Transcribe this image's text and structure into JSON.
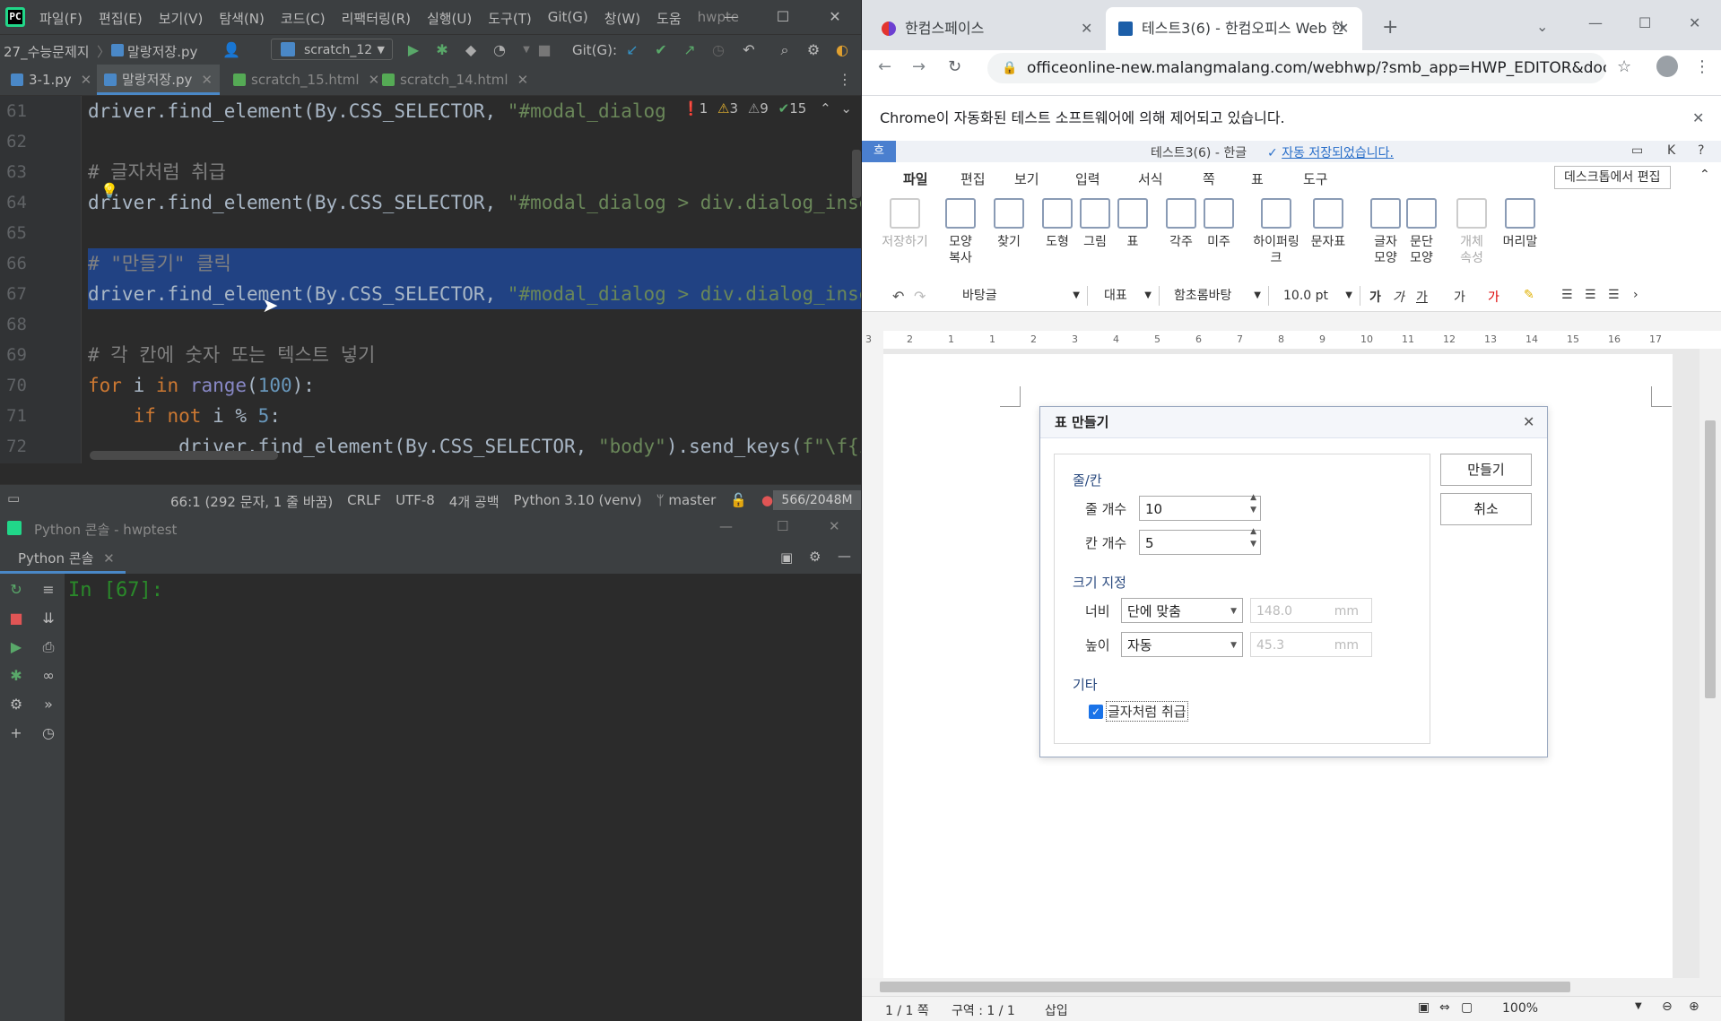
{
  "ide": {
    "menus": [
      "파일(F)",
      "편집(E)",
      "보기(V)",
      "탐색(N)",
      "코드(C)",
      "리팩터링(R)",
      "실행(U)",
      "도구(T)",
      "Git(G)",
      "창(W)",
      "도움",
      "hwpte"
    ],
    "nav": {
      "project": "27_수능문제지",
      "file": "말랑저장.py",
      "run_config": "scratch_12",
      "git_label": "Git(G):"
    },
    "tabs": [
      {
        "label": "3-1.py"
      },
      {
        "label": "말랑저장.py"
      },
      {
        "label": "scratch_15.html"
      },
      {
        "label": "scratch_14.html"
      }
    ],
    "inspections": {
      "errors": "1",
      "warnings": "3",
      "weak_warnings": "9",
      "ok": "15"
    },
    "lines": [
      {
        "no": "61",
        "parts": [
          {
            "t": "driver.find_element(By.CSS_SELECTOR, ",
            "c": ""
          },
          {
            "t": "\"#modal_dialog > ",
            "c": "st"
          }
        ]
      },
      {
        "no": "62",
        "parts": []
      },
      {
        "no": "63",
        "parts": [
          {
            "t": "# 글자처럼 취급",
            "c": "cm"
          }
        ]
      },
      {
        "no": "64",
        "parts": [
          {
            "t": "driver.find_element(By.CSS_SELECTOR, ",
            "c": ""
          },
          {
            "t": "\"#modal_dialog > div.dialog_insert_",
            "c": "st"
          }
        ]
      },
      {
        "no": "65",
        "parts": []
      },
      {
        "no": "66",
        "parts": [
          {
            "t": "# \"만들기\" 클릭",
            "c": "cm"
          }
        ]
      },
      {
        "no": "67",
        "parts": [
          {
            "t": "driver.find_element(By.CSS_SELECTOR, ",
            "c": ""
          },
          {
            "t": "\"#modal_dialog > div.dialog_insert_",
            "c": "st"
          }
        ]
      },
      {
        "no": "68",
        "parts": []
      },
      {
        "no": "69",
        "parts": [
          {
            "t": "# 각 칸에 숫자 또는 텍스트 넣기",
            "c": "cm"
          }
        ]
      },
      {
        "no": "70",
        "parts": [
          {
            "t": "for",
            "c": "kw"
          },
          {
            "t": " i ",
            "c": ""
          },
          {
            "t": "in",
            "c": "kw"
          },
          {
            "t": " ",
            "c": ""
          },
          {
            "t": "range",
            "c": "fn"
          },
          {
            "t": "(",
            "c": ""
          },
          {
            "t": "100",
            "c": "nm"
          },
          {
            "t": "):",
            "c": ""
          }
        ]
      },
      {
        "no": "71",
        "parts": [
          {
            "t": "    ",
            "c": ""
          },
          {
            "t": "if not",
            "c": "kw"
          },
          {
            "t": " i % ",
            "c": ""
          },
          {
            "t": "5",
            "c": "nm"
          },
          {
            "t": ":",
            "c": ""
          }
        ]
      },
      {
        "no": "72",
        "parts": [
          {
            "t": "        driver.find_element(By.CSS_SELECTOR, ",
            "c": ""
          },
          {
            "t": "\"body\"",
            "c": "st"
          },
          {
            "t": ").send_keys(",
            "c": ""
          },
          {
            "t": "f\"\\f{i}\"",
            "c": "st"
          },
          {
            "t": ")",
            "c": ""
          }
        ]
      }
    ],
    "status": {
      "items": [
        "66:1 (292 문자, 1 줄 바꿈)",
        "CRLF",
        "UTF-8",
        "4개 공백",
        "Python 3.10 (venv)",
        "master"
      ],
      "memory": "566/2048M"
    },
    "console": {
      "window_title": "Python 콘솔 - hwptest",
      "tab": "Python 콘솔",
      "prompt": "In [67]:"
    }
  },
  "chrome": {
    "tabs": [
      {
        "label": "한컴스페이스"
      },
      {
        "label": "테스트3(6) - 한컴오피스 Web 한"
      }
    ],
    "url": "officeonline-new.malangmalang.com/webhwp/?smb_app=HWP_EDITOR&docId...",
    "infobar": "Chrome이 자동화된 테스트 소프트웨어에 의해 제어되고 있습니다.",
    "hwp": {
      "title": "테스트3(6) - 한글",
      "autosave": "자동 저장되었습니다.",
      "menus": [
        "파일",
        "편집",
        "보기",
        "입력",
        "서식",
        "쪽",
        "표",
        "도구"
      ],
      "desktop_edit": "데스크톱에서 편집",
      "ribbon": [
        {
          "label": "저장하기",
          "icon": "save-icon",
          "disabled": true
        },
        {
          "label": "모양\n복사",
          "icon": "format-painter-icon",
          "disabled": false
        },
        {
          "label": "찾기",
          "icon": "binoculars-icon",
          "disabled": false
        },
        {
          "label": "도형",
          "icon": "shape-icon",
          "disabled": false
        },
        {
          "label": "그림",
          "icon": "picture-icon",
          "disabled": false
        },
        {
          "label": "표",
          "icon": "table-icon",
          "disabled": false
        },
        {
          "label": "각주",
          "icon": "footnote-icon",
          "disabled": false
        },
        {
          "label": "미주",
          "icon": "endnote-icon",
          "disabled": false
        },
        {
          "label": "하이퍼링크",
          "icon": "hyperlink-icon",
          "disabled": false
        },
        {
          "label": "문자표",
          "icon": "symbol-icon",
          "disabled": false
        },
        {
          "label": "글자\n모양",
          "icon": "char-shape-icon",
          "disabled": false
        },
        {
          "label": "문단\n모양",
          "icon": "para-shape-icon",
          "disabled": false
        },
        {
          "label": "개체\n속성",
          "icon": "object-prop-icon",
          "disabled": true
        },
        {
          "label": "머리말",
          "icon": "header-icon",
          "disabled": false
        }
      ],
      "format": {
        "style": "바탕글",
        "lang": "대표",
        "font": "함초롬바탕",
        "size": "10.0 pt"
      },
      "ruler_marks": [
        "3",
        "2",
        "1",
        "1",
        "2",
        "3",
        "4",
        "5",
        "6",
        "7",
        "8",
        "9",
        "10",
        "11",
        "12",
        "13",
        "14",
        "15",
        "16",
        "17"
      ],
      "status": {
        "page": "1 / 1 쪽",
        "section": "구역 : 1 / 1",
        "mode": "삽입",
        "zoom": "100%"
      },
      "dialog": {
        "title": "표 만들기",
        "rowcol_label": "줄/칸",
        "rows_label": "줄 개수",
        "rows_value": "10",
        "cols_label": "칸 개수",
        "cols_value": "5",
        "size_label": "크기 지정",
        "width_label": "너비",
        "width_mode": "단에 맞춤",
        "width_value": "148.0",
        "height_label": "높이",
        "height_mode": "자동",
        "height_value": "45.3",
        "unit": "mm",
        "etc_label": "기타",
        "treat_as_char": "글자처럼 취급",
        "treat_as_char_checked": true,
        "create_button": "만들기",
        "cancel_button": "취소"
      }
    }
  }
}
